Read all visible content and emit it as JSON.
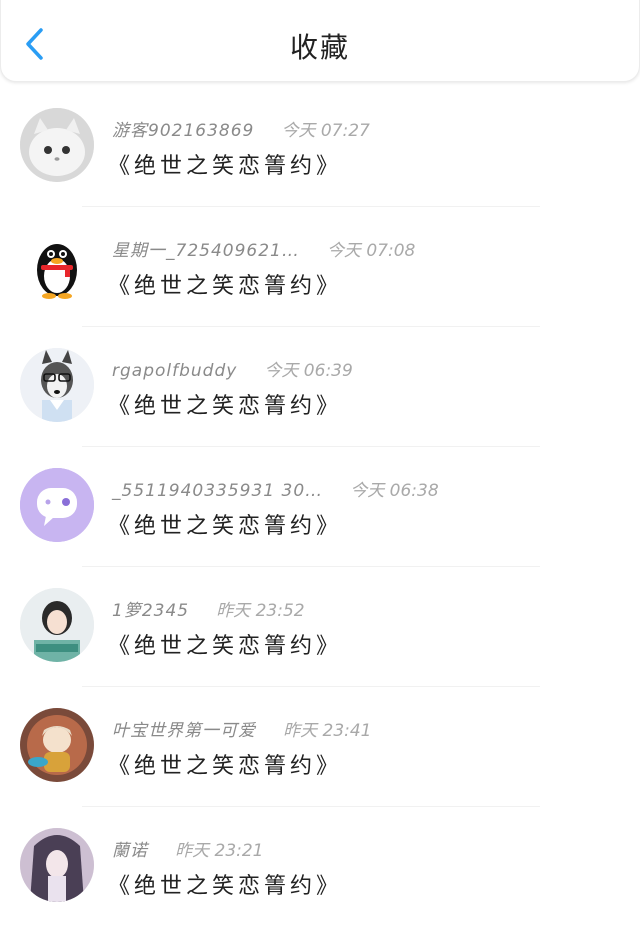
{
  "header": {
    "title": "收藏",
    "back_icon": "chevron-left-icon",
    "accent_color": "#2a9df4"
  },
  "items": [
    {
      "user": "游客902163869",
      "time": "今天 07:27",
      "content": "《绝世之笑恋箐约》",
      "avatar": "white-cat"
    },
    {
      "user": "星期一_725409621…",
      "time": "今天 07:08",
      "content": "《绝世之笑恋箐约》",
      "avatar": "qq-penguin"
    },
    {
      "user": "rgapolfbuddy",
      "time": "今天 06:39",
      "content": "《绝世之笑恋箐约》",
      "avatar": "husky-glasses"
    },
    {
      "user": "_5511940335931 30…",
      "time": "今天 06:38",
      "content": "《绝世之笑恋箐约》",
      "avatar": "purple-chat-bubble"
    },
    {
      "user": "1箩2345",
      "time": "昨天 23:52",
      "content": "《绝世之笑恋箐约》",
      "avatar": "girl-photo"
    },
    {
      "user": "叶宝世界第一可爱",
      "time": "昨天 23:41",
      "content": "《绝世之笑恋箐约》",
      "avatar": "anime-character"
    },
    {
      "user": "蘭诺",
      "time": "昨天 23:21",
      "content": "《绝世之笑恋箐约》",
      "avatar": "anime-dark-hair"
    }
  ]
}
